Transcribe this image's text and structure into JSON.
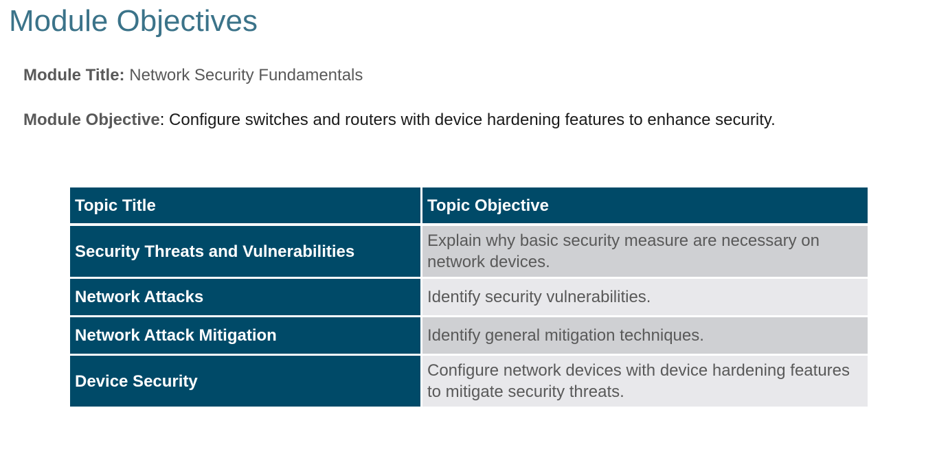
{
  "slide": {
    "title": "Module Objectives"
  },
  "module": {
    "title_label": "Module Title:",
    "title_value": " Network Security Fundamentals",
    "objective_label": "Module Objective",
    "objective_separator": ":",
    "objective_value": " Configure switches and routers with device hardening features to enhance security."
  },
  "table": {
    "headers": [
      "Topic Title",
      "Topic Objective"
    ],
    "rows": [
      {
        "topic": "Security Threats and Vulnerabilities",
        "objective": "Explain why basic security measure are necessary on network devices."
      },
      {
        "topic": "Network Attacks",
        "objective": "Identify security vulnerabilities."
      },
      {
        "topic": "Network Attack Mitigation",
        "objective": "Identify general mitigation techniques."
      },
      {
        "topic": "Device Security",
        "objective": "Configure network devices with device hardening features to mitigate security threats."
      }
    ]
  },
  "colors": {
    "title_text": "#3b7389",
    "header_fill": "#004a68",
    "row_fill_dark": "#cfd0d3",
    "row_fill_light": "#e8e8eb",
    "body_text_gray": "#595959"
  }
}
